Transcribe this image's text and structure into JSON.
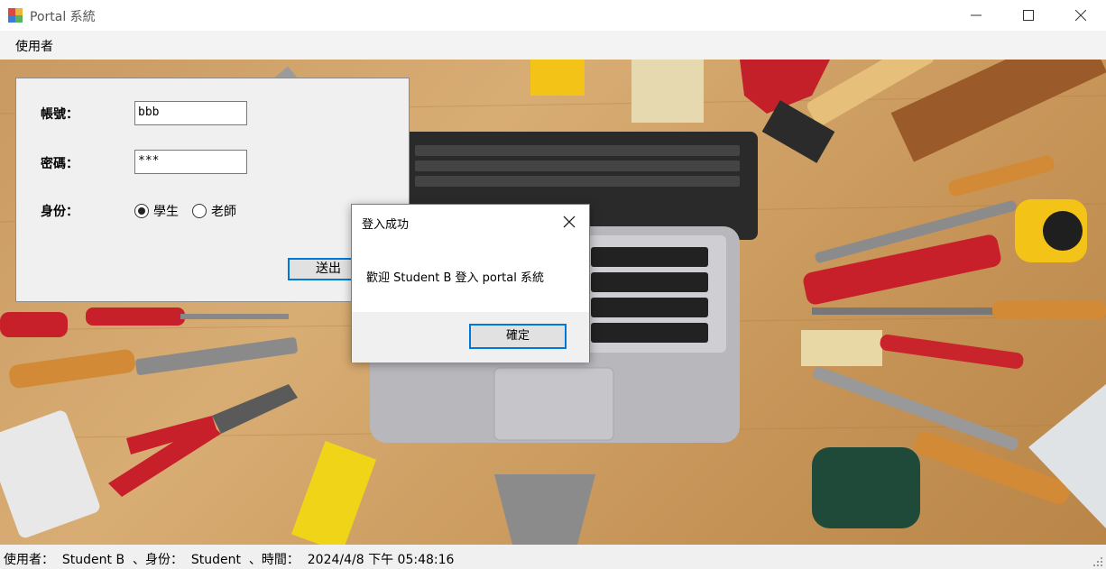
{
  "window": {
    "title": "Portal 系統",
    "icon": "app-window-icon",
    "controls": [
      "minimize-icon",
      "maximize-icon",
      "close-icon"
    ]
  },
  "menu": {
    "items": [
      {
        "label": "使用者"
      }
    ]
  },
  "login": {
    "account_label": "帳號：",
    "account_value": "bbb",
    "password_label": "密碼：",
    "password_value": "***",
    "role_label": "身份：",
    "role_options": [
      {
        "label": "學生",
        "selected": true
      },
      {
        "label": "老師",
        "selected": false
      }
    ],
    "submit_label": "送出"
  },
  "dialog": {
    "title": "登入成功",
    "message": "歡迎 Student B 登入 portal 系統",
    "ok_label": "確定"
  },
  "status": {
    "text": "使用者：  Student B  、身份：  Student  、時間：  2024/4/8 下午 05:48:16"
  },
  "colors": {
    "accent": "#0078d7",
    "panel": "#f0f0f0",
    "menubar": "#f3f3f3"
  }
}
